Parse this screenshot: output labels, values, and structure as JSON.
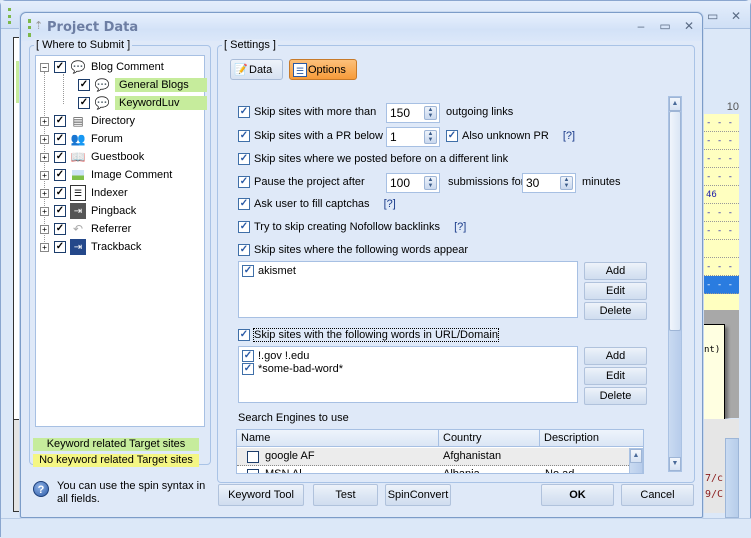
{
  "background_window": {
    "column_header": "10",
    "list_cells": [
      "- - -",
      "- - -",
      "- - -",
      "- - -",
      "46",
      "- - -",
      "- - -",
      "",
      "- - -",
      "- - -"
    ],
    "tooltip_fragment": "nt)",
    "red_lines": [
      "7/c",
      "9/C"
    ]
  },
  "dialog": {
    "title": "Project Data",
    "minimize": "–",
    "maximize": "▭",
    "close": "✕"
  },
  "left": {
    "group_label": "[ Where to Submit ]",
    "tree": [
      {
        "label": "Blog Comment",
        "icon": "speech-bubble-icon",
        "expander": "−",
        "checked": true
      },
      {
        "label": "General Blogs",
        "icon": "speech-bubble-icon",
        "checked": true,
        "highlight": "green"
      },
      {
        "label": "KeywordLuv",
        "icon": "speech-bubble-icon",
        "checked": true,
        "highlight": "green"
      },
      {
        "label": "Directory",
        "icon": "directory-icon",
        "expander": "+",
        "checked": true
      },
      {
        "label": "Forum",
        "icon": "forum-users-icon",
        "expander": "+",
        "checked": true
      },
      {
        "label": "Guestbook",
        "icon": "book-icon",
        "expander": "+",
        "checked": true
      },
      {
        "label": "Image Comment",
        "icon": "image-icon",
        "expander": "+",
        "checked": true
      },
      {
        "label": "Indexer",
        "icon": "indexer-icon",
        "expander": "+",
        "checked": true
      },
      {
        "label": "Pingback",
        "icon": "pingback-icon",
        "expander": "+",
        "checked": true
      },
      {
        "label": "Referrer",
        "icon": "referrer-icon",
        "expander": "+",
        "checked": true
      },
      {
        "label": "Trackback",
        "icon": "trackback-icon",
        "expander": "+",
        "checked": true
      }
    ],
    "legend_green": "Keyword related Target sites",
    "legend_yellow": "No keyword related Target sites",
    "help_text": "You can use the spin syntax in all fields."
  },
  "settings": {
    "group_label": "[ Settings ]",
    "tabs": [
      {
        "label": "Data",
        "active": false
      },
      {
        "label": "Options",
        "active": true
      }
    ],
    "options": {
      "max_outgoing": {
        "label": "Skip sites with more than",
        "value": "150",
        "suffix": "outgoing links",
        "checked": true
      },
      "pr_below": {
        "label": "Skip sites with a PR below",
        "value": "1",
        "checked": true
      },
      "unknown_pr": {
        "label": "Also unknown PR",
        "help": "[?]",
        "checked": true
      },
      "posted_before": {
        "label": "Skip sites where we posted before on a different link",
        "checked": true
      },
      "pause": {
        "label": "Pause the project after",
        "value": "100",
        "middle": "submissions for",
        "minutes_value": "30",
        "suffix": "minutes",
        "checked": true
      },
      "captchas": {
        "label": "Ask user to fill captchas",
        "help": "[?]",
        "checked": true
      },
      "nofollow": {
        "label": "Try to skip creating Nofollow backlinks",
        "help": "[?]",
        "checked": true
      },
      "words_appear": {
        "label": "Skip sites where the following words appear",
        "checked": true,
        "items": [
          "akismet"
        ]
      },
      "words_url": {
        "label": "Skip sites with the following words in URL/Domain",
        "checked": true,
        "items": [
          "!.gov !.edu",
          "*some-bad-word*"
        ]
      }
    },
    "list_buttons": {
      "add": "Add",
      "edit": "Edit",
      "delete": "Delete"
    },
    "search_engines": {
      "label": "Search Engines to use",
      "columns": [
        "Name",
        "Country",
        "Description"
      ],
      "rows": [
        {
          "name": "google AF",
          "country": "Afghanistan",
          "description": "",
          "checked": false
        },
        {
          "name": "MSN Al",
          "country": "Albania",
          "description": "No ad",
          "checked": false
        }
      ]
    }
  },
  "footer": {
    "keyword_tool": "Keyword Tool",
    "test": "Test",
    "spin_convert": "SpinConvert",
    "ok": "OK",
    "cancel": "Cancel"
  }
}
